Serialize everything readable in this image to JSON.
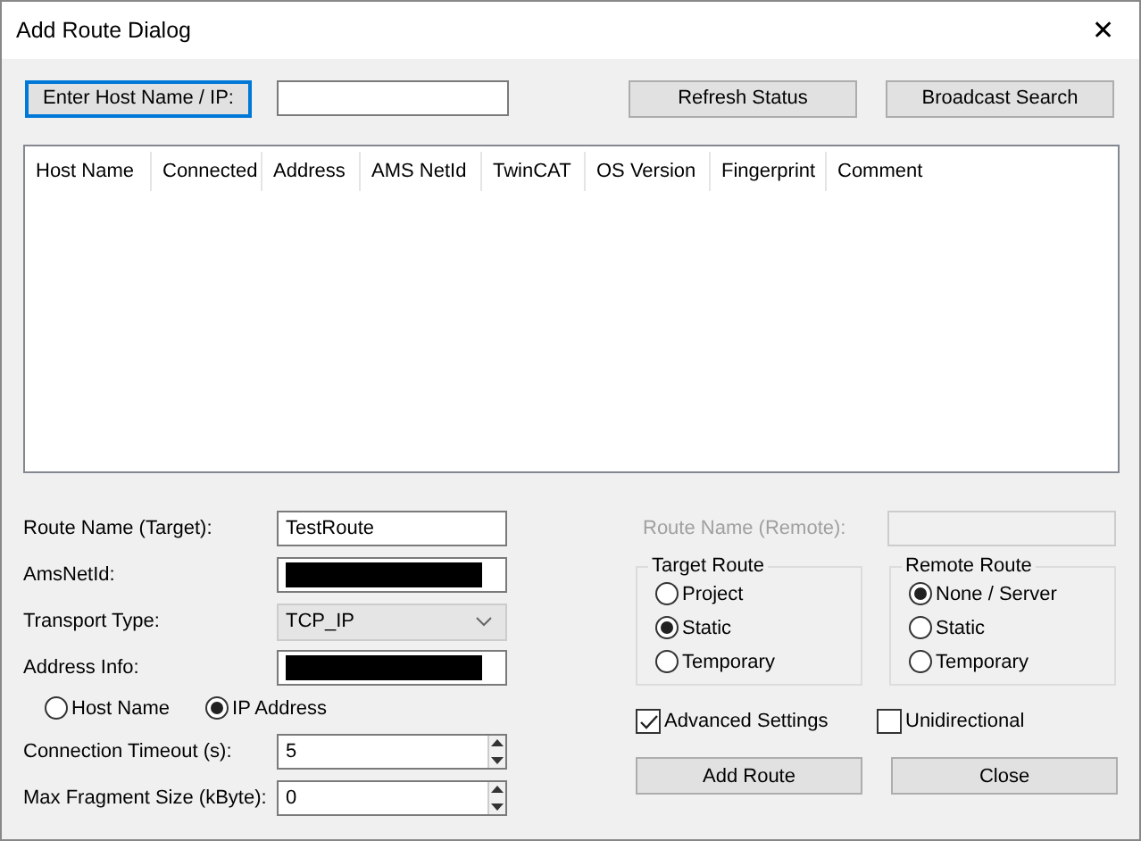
{
  "window": {
    "title": "Add Route Dialog",
    "close": "✕"
  },
  "host_search": {
    "button": "Enter Host Name / IP:"
  },
  "top_buttons": [
    "Refresh Status",
    "Broadcast Search"
  ],
  "table": {
    "columns": [
      "Host Name",
      "Connected",
      "Address",
      "AMS NetId",
      "TwinCAT",
      "OS Version",
      "Fingerprint",
      "Comment"
    ]
  },
  "form": [
    {
      "kind": "text",
      "label": "Route Name (Target):",
      "value": "TestRoute"
    },
    {
      "kind": "text",
      "label": "AmsNetId:",
      "redacted": true
    },
    {
      "kind": "select",
      "label": "Transport Type:",
      "value": "TCP_IP"
    },
    {
      "kind": "text",
      "label": "Address Info:",
      "redacted": true
    }
  ],
  "address_mode": [
    {
      "label": "Host Name",
      "selected": false
    },
    {
      "label": "IP Address",
      "selected": true
    }
  ],
  "spinners": [
    {
      "label": "Connection Timeout (s):",
      "value": "5"
    },
    {
      "label": "Max Fragment Size (kByte):",
      "value": "0"
    }
  ],
  "remote_name": {
    "label": "Route Name (Remote):",
    "disabled": true
  },
  "groups": [
    {
      "title": "Target Route",
      "options": [
        {
          "label": "Project",
          "selected": false
        },
        {
          "label": "Static",
          "selected": true
        },
        {
          "label": "Temporary",
          "selected": false
        }
      ]
    },
    {
      "title": "Remote Route",
      "options": [
        {
          "label": "None / Server",
          "selected": true
        },
        {
          "label": "Static",
          "selected": false
        },
        {
          "label": "Temporary",
          "selected": false
        }
      ]
    }
  ],
  "checkboxes": [
    {
      "label": "Advanced Settings",
      "checked": true
    },
    {
      "label": "Unidirectional",
      "checked": false
    }
  ],
  "bottom_buttons": [
    "Add Route",
    "Close"
  ]
}
